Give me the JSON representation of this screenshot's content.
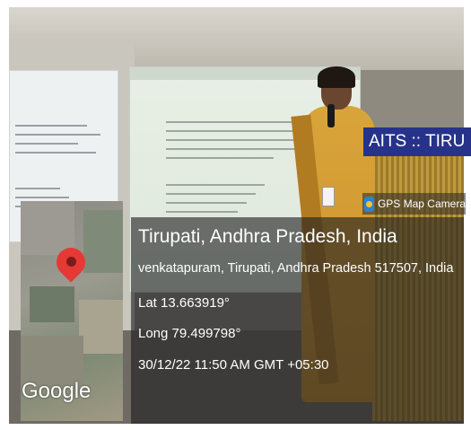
{
  "photo": {
    "banner_text": "AITS :: TIRU"
  },
  "overlay": {
    "badge_label": "GPS Map Camera",
    "badge_icon": "gps-map-camera-icon",
    "location_title": "Tirupati, Andhra Pradesh, India",
    "address": "venkatapuram, Tirupati, Andhra Pradesh 517507, India",
    "latitude": "Lat 13.663919°",
    "longitude": "Long 79.499798°",
    "timestamp": "30/12/22 11:50 AM GMT +05:30"
  },
  "map": {
    "logo": "Google",
    "pin_icon": "location-pin-icon",
    "pin_color": "#e53935"
  },
  "colors": {
    "banner_blue": "#27338a",
    "panel_bg": "rgba(30,30,32,0.62)"
  }
}
